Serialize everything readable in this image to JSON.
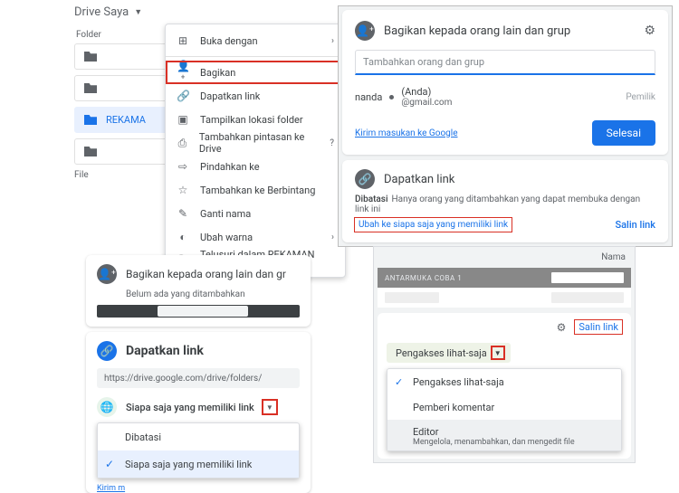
{
  "drive": {
    "title": "Drive Saya",
    "section_folder": "Folder",
    "section_file": "File",
    "active_folder": "REKAMA"
  },
  "ctx": {
    "open_with": "Buka dengan",
    "share": "Bagikan",
    "get_link": "Dapatkan link",
    "show_location": "Tampilkan lokasi folder",
    "add_shortcut": "Tambahkan pintasan ke Drive",
    "move_to": "Pindahkan ke",
    "star": "Tambahkan ke Berbintang",
    "rename": "Ganti nama",
    "change_color": "Ubah warna",
    "search_in": "Telusuri dalam REKAMAN WAWANCARA"
  },
  "share": {
    "title": "Bagikan kepada orang lain dan grup",
    "placeholder": "Tambahkan orang dan grup",
    "user_name": "nanda",
    "you": "(Anda)",
    "email": "@gmail.com",
    "role_owner": "Pemilik",
    "feedback": "Kirim masukan ke Google",
    "done": "Selesai"
  },
  "getlink": {
    "title": "Dapatkan link",
    "restricted": "Dibatasi",
    "restricted_desc": "Hanya orang yang ditambahkan yang dapat membuka dengan link ini",
    "change": "Ubah ke siapa saja yang memiliki link",
    "copy": "Salin link"
  },
  "panelC": {
    "share_title": "Bagikan kepada orang lain dan gr",
    "empty": "Belum ada yang ditambahkan",
    "url": "https://drive.google.com/drive/folders/",
    "anyone": "Siapa saja yang memiliki link",
    "opt_restricted": "Dibatasi",
    "opt_anyone": "Siapa saja yang memiliki link",
    "feedback": "Kirim m"
  },
  "panelD": {
    "col_name": "Nama",
    "band_caption": "ANTARMUKA COBA 1",
    "copy": "Salin link",
    "viewer_badge": "Pengakses lihat-saja",
    "opt_viewer": "Pengakses lihat-saja",
    "opt_commenter": "Pemberi komentar",
    "opt_editor": "Editor",
    "opt_editor_sub": "Mengelola, menambahkan, dan mengedit file"
  }
}
